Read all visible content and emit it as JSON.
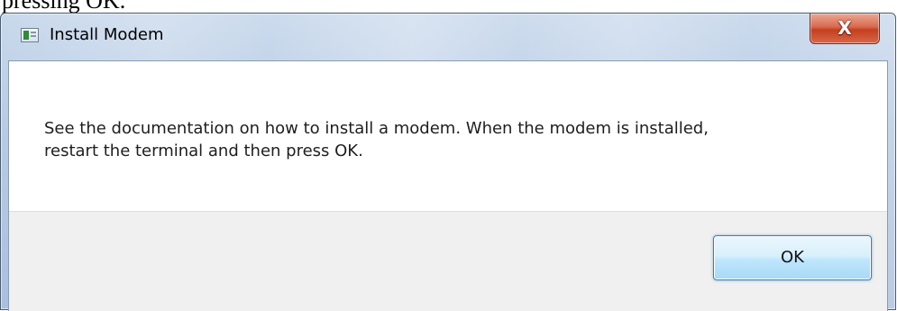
{
  "background_text": "pressing OK.",
  "window": {
    "title": "Install Modem",
    "app_icon": "app-window-icon",
    "close_glyph": "X",
    "frame_color": "#b7cbe4",
    "close_color": "#c4401f"
  },
  "dialog": {
    "message_lines": [
      "See the documentation on how to install a modem. When the modem is installed,",
      "restart the terminal and then press OK."
    ],
    "ok_label": "OK",
    "button_area_color": "#f0f0f0",
    "ok_border_color": "#3c7fb1"
  }
}
